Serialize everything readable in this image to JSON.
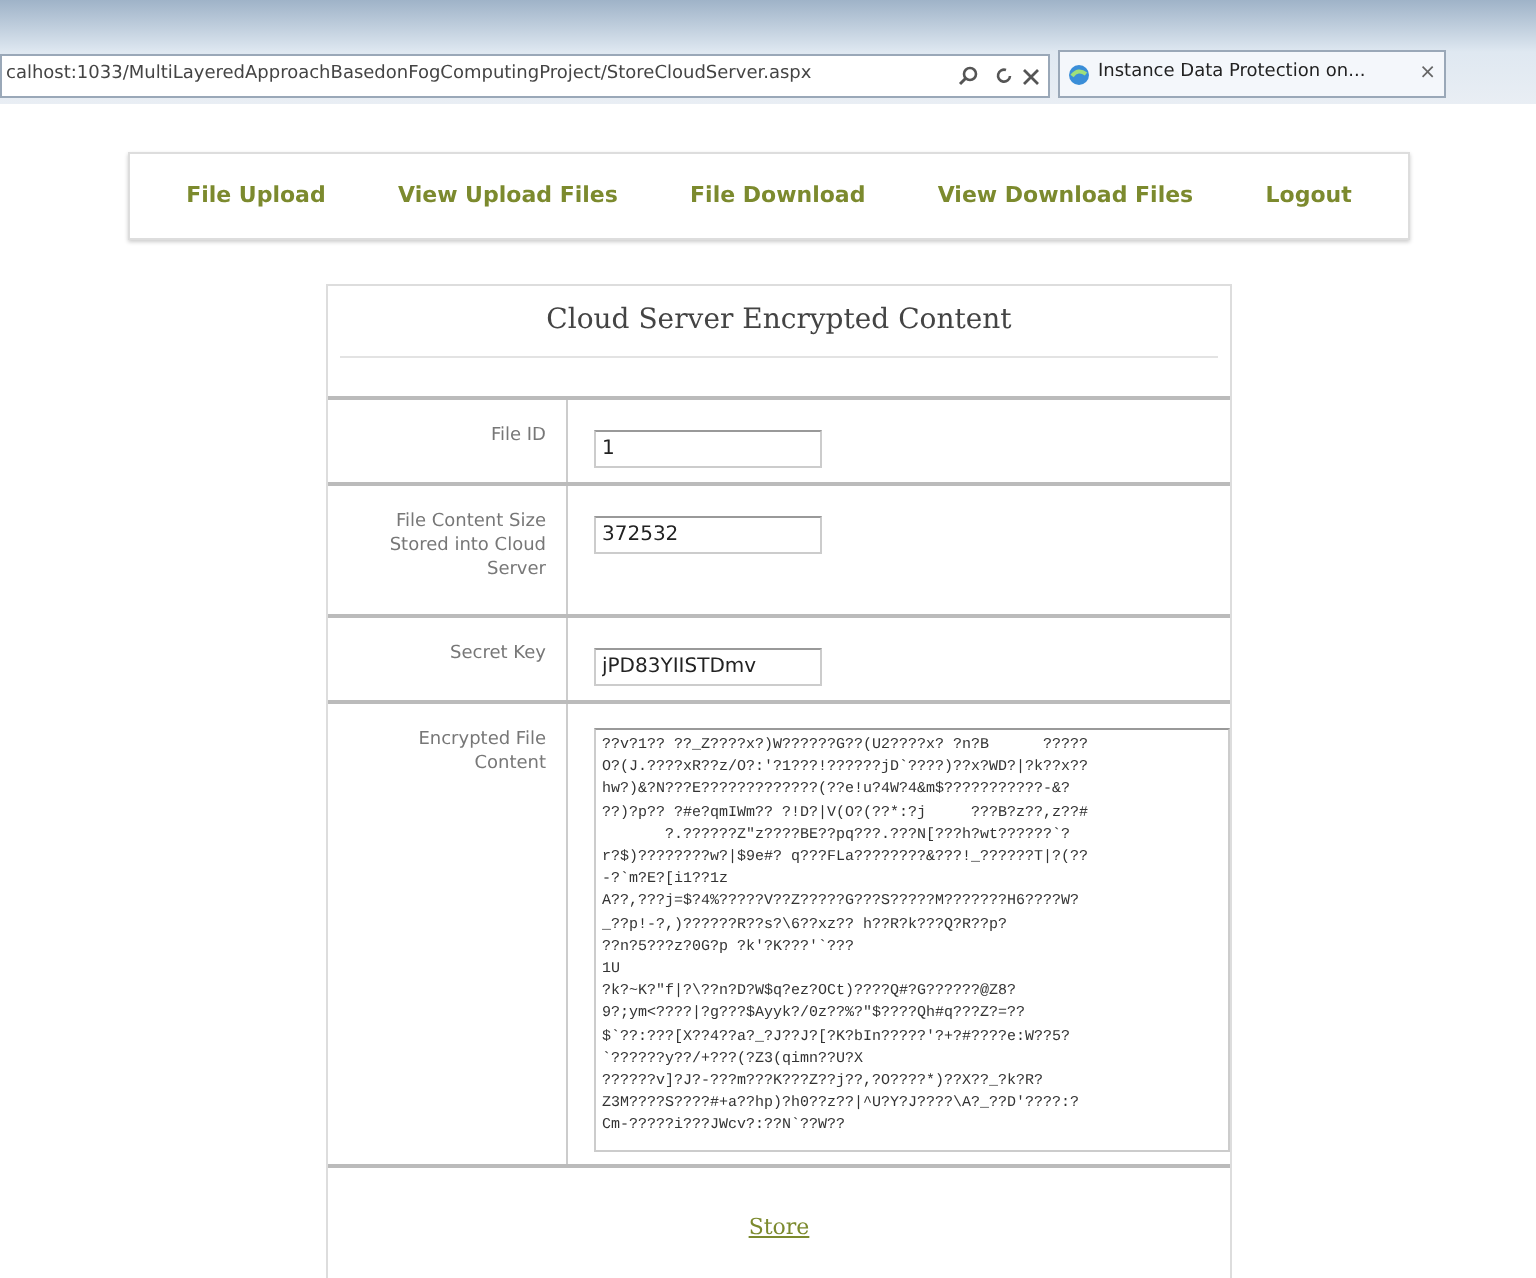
{
  "browser": {
    "address": "calhost:1033/MultiLayeredApproachBasedonFogComputingProject/StoreCloudServer.aspx",
    "tab": {
      "title": "Instance Data Protection on...",
      "close": "×"
    }
  },
  "nav": [
    {
      "label": "File Upload"
    },
    {
      "label": "View Upload Files"
    },
    {
      "label": "File Download"
    },
    {
      "label": "View Download Files"
    },
    {
      "label": "Logout"
    }
  ],
  "form": {
    "title": "Cloud Server Encrypted Content",
    "fields": [
      {
        "label": "File ID",
        "value": "1"
      },
      {
        "label": "File Content Size Stored into Cloud Server",
        "value": "372532"
      },
      {
        "label": "Secret Key",
        "value": "jPD83YIISTDmv"
      }
    ],
    "content": {
      "label": "Encrypted File Content",
      "value": "??v?1?? ??_Z????x?)W??????G??(U2????x? ?n?B      ?????\nO?(J.????xR??z/O?:'?1???!??????jD`????)??x?WD?|?k??x??\nhw?)&?N???E?????????????(??e!u?4W?4&m$???????????-&?\n??)?p?? ?#e?qmIWm?? ?!D?|V(O?(??*:?j     ???B?z??,z??#\n       ?.??????Z\"z????BE??pq???.???N[???h?wt??????`?\nr?$)????????w?|$9e#? q???FLa????????&???!_??????T|?(??\n-?`m?E?[i1??1z\nA??,???j=$?4%?????V??Z?????G???S?????M???????H6????W?\n_??p!-?,)??????R??s?\\6??xz?? h??R?k???Q?R??p?\n??n?5???z?0G?p ?k'?K???'`???\n1U\n?k?~K?\"f|?\\??n?D?W$q?ez?OCt)????Q#?G??????@Z8?\n9?;ym<????|?g???$Ayyk?/0z??%?\"$????Qh#q???Z?=??\n$`??:???[X??4??a?_?J??J?[?K?bIn?????'?+?#????e:W??5?\n`??????y??/+???(?Z3(qimn??U?X\n??????v]?J?-???m???K???Z??j??,?O????*)??X??_?k?R?\nZ3M????S????#+a??hp)?h0??z??|^U?Y?J????\\A?_??D'????:?\nCm-?????i???JWcv?:??N`??W??"
    },
    "submit": "Store"
  }
}
